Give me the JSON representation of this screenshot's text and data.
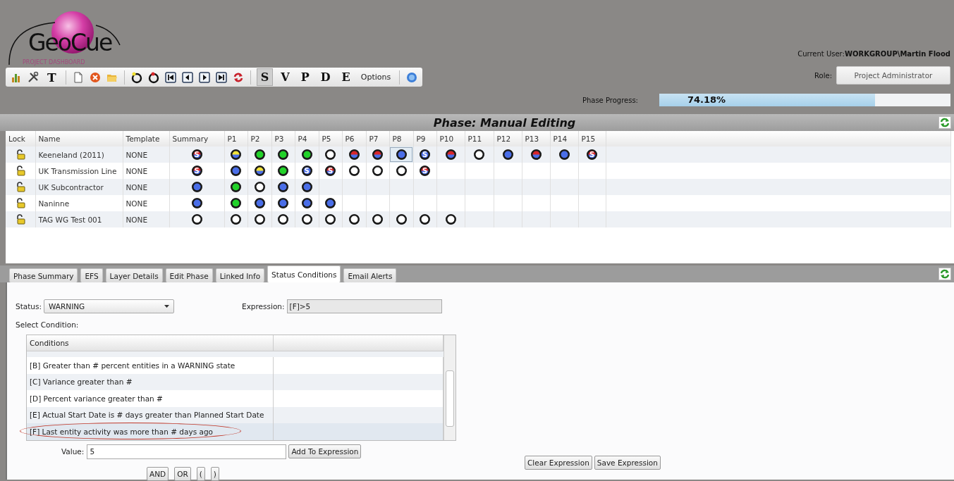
{
  "logo": {
    "name": "GeoCue",
    "subtitle": "PROJECT DASHBOARD"
  },
  "toolbar": {
    "tool_label": "T",
    "view_buttons": [
      {
        "label": "S",
        "selected": true
      },
      {
        "label": "V",
        "selected": false
      },
      {
        "label": "P",
        "selected": false
      },
      {
        "label": "D",
        "selected": false
      },
      {
        "label": "E",
        "selected": false
      }
    ],
    "options_label": "Options"
  },
  "user": {
    "label": "Current User:",
    "name": "WORKGROUP\\Martin Flood"
  },
  "role": {
    "label": "Role:",
    "value": "Project Administrator"
  },
  "progress": {
    "label": "Phase Progress:",
    "reading": "74.18%",
    "level": 0.7418
  },
  "phase_title": "Phase: Manual Editing",
  "grid": {
    "columns": [
      "Lock",
      "Name",
      "Template",
      "Summary",
      "P1",
      "P2",
      "P3",
      "P4",
      "P5",
      "P6",
      "P7",
      "P8",
      "P9",
      "P10",
      "P11",
      "P12",
      "P13",
      "P14",
      "P15"
    ],
    "rows": [
      {
        "name": "Keeneland (2011)",
        "template": "NONE",
        "summary": {
          "kind": "red-blue",
          "mark": "S"
        },
        "phases": [
          {
            "kind": "yellow-blue",
            "selected": false
          },
          {
            "kind": "green",
            "selected": false
          },
          {
            "kind": "green",
            "selected": false
          },
          {
            "kind": "green",
            "selected": false
          },
          {
            "kind": "open",
            "selected": false
          },
          {
            "kind": "red-blue",
            "selected": false
          },
          {
            "kind": "red-blue",
            "selected": false
          },
          {
            "kind": "blue",
            "selected": true
          },
          {
            "kind": "blue",
            "mark": "S",
            "selected": false
          },
          {
            "kind": "red-blue",
            "selected": false
          },
          {
            "kind": "open",
            "selected": false
          },
          {
            "kind": "blue",
            "selected": false
          },
          {
            "kind": "red-blue",
            "selected": false
          },
          {
            "kind": "blue",
            "selected": false
          },
          {
            "kind": "red-blue",
            "mark": "S",
            "selected": false
          }
        ]
      },
      {
        "name": "UK Transmission Line",
        "template": "NONE",
        "summary": {
          "kind": "red-blue",
          "mark": "S"
        },
        "phases": [
          {
            "kind": "blue",
            "selected": false
          },
          {
            "kind": "yellow-blue",
            "selected": false
          },
          {
            "kind": "green",
            "selected": false
          },
          {
            "kind": "blue",
            "mark": "S",
            "selected": false
          },
          {
            "kind": "red-blue",
            "mark": "S",
            "selected": false
          },
          {
            "kind": "open",
            "selected": false
          },
          {
            "kind": "open",
            "selected": false
          },
          {
            "kind": "open",
            "selected": false
          },
          {
            "kind": "red-blue",
            "mark": "S",
            "selected": false
          }
        ]
      },
      {
        "name": "UK Subcontractor",
        "template": "NONE",
        "summary": {
          "kind": "blue"
        },
        "phases": [
          {
            "kind": "green",
            "selected": false
          },
          {
            "kind": "open",
            "selected": false
          },
          {
            "kind": "blue",
            "selected": false
          },
          {
            "kind": "blue",
            "selected": false
          }
        ]
      },
      {
        "name": "Naninne",
        "template": "NONE",
        "summary": {
          "kind": "blue"
        },
        "phases": [
          {
            "kind": "green",
            "selected": false
          },
          {
            "kind": "blue",
            "selected": false
          },
          {
            "kind": "blue",
            "selected": false
          },
          {
            "kind": "blue",
            "selected": false
          },
          {
            "kind": "blue",
            "selected": false
          }
        ]
      },
      {
        "name": "TAG WG Test 001",
        "template": "NONE",
        "summary": {
          "kind": "open"
        },
        "phases": [
          {
            "kind": "open",
            "selected": false
          },
          {
            "kind": "open",
            "selected": false
          },
          {
            "kind": "open",
            "selected": false
          },
          {
            "kind": "open",
            "selected": false
          },
          {
            "kind": "open",
            "selected": false
          },
          {
            "kind": "open",
            "selected": false
          },
          {
            "kind": "open",
            "selected": false
          },
          {
            "kind": "open",
            "selected": false
          },
          {
            "kind": "open",
            "selected": false
          },
          {
            "kind": "open",
            "selected": false
          }
        ]
      }
    ]
  },
  "tabs": [
    {
      "label": "Phase Summary",
      "selected": false
    },
    {
      "label": "EFS",
      "selected": false
    },
    {
      "label": "Layer Details",
      "selected": false
    },
    {
      "label": "Edit Phase",
      "selected": false
    },
    {
      "label": "Linked Info",
      "selected": false
    },
    {
      "label": "Status Conditions",
      "selected": true
    },
    {
      "label": "Email Alerts",
      "selected": false
    }
  ],
  "status": {
    "label": "Status:",
    "value": "WARNING"
  },
  "expression": {
    "label": "Expression:",
    "value": "[F]>5"
  },
  "select_condition_label": "Select Condition:",
  "conditions": {
    "header": "Conditions",
    "items": [
      {
        "label": "[B] Greater than # percent entities in a WARNING state",
        "selected": false
      },
      {
        "label": "[C] Variance greater than #",
        "selected": false
      },
      {
        "label": "[D] Percent variance greater than #",
        "selected": false
      },
      {
        "label": "[E] Actual Start Date is # days greater than Planned Start Date",
        "selected": false
      },
      {
        "label": "[F] Last entity activity was more than # days ago",
        "selected": true,
        "circled": true
      }
    ]
  },
  "value": {
    "label": "Value:",
    "value": "5"
  },
  "add_button": "Add To Expression",
  "operators": [
    "AND",
    "OR",
    "(",
    ")"
  ],
  "actions": [
    "Clear Expression",
    "Save Expression"
  ]
}
